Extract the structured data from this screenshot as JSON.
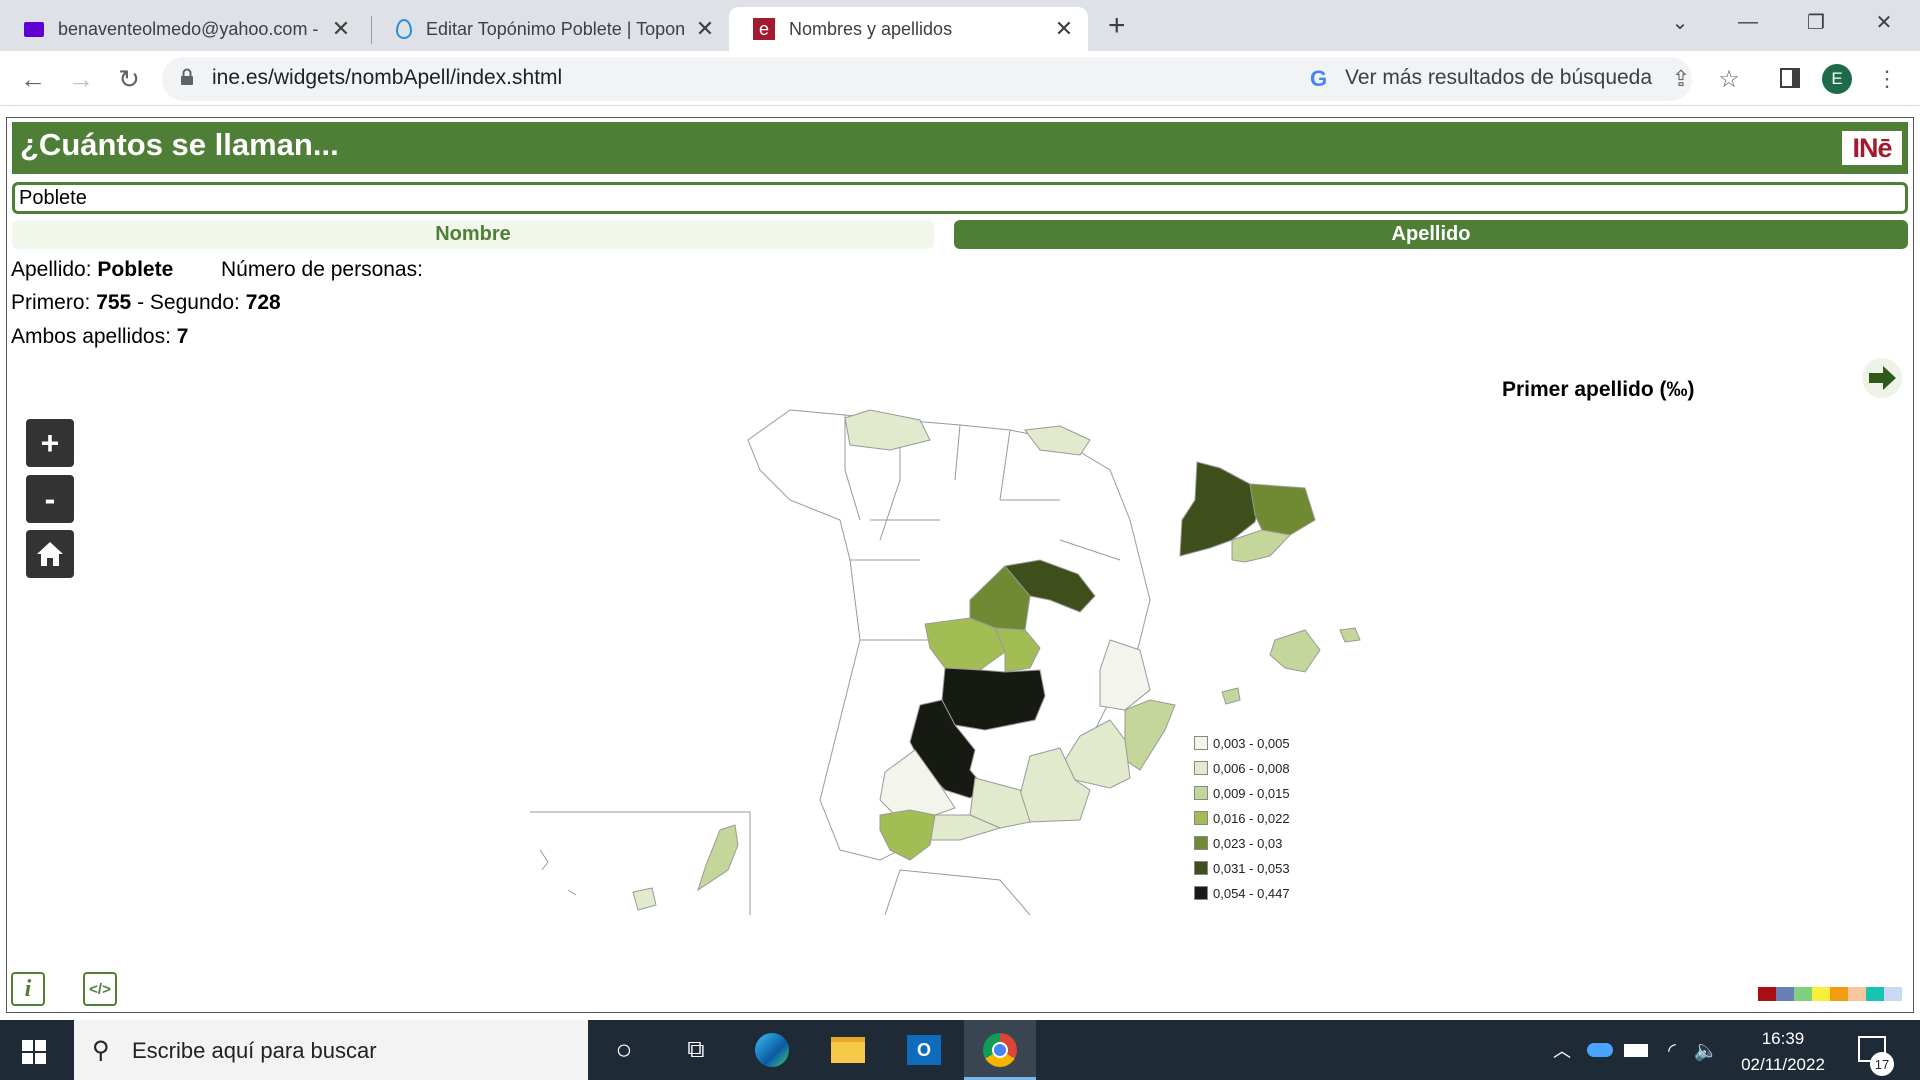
{
  "browser": {
    "tabs": [
      {
        "label": "benaventeolmedo@yahoo.com -",
        "icon": "mail-icon"
      },
      {
        "label": "Editar Topónimo Poblete | Topon",
        "icon": "drupal-icon"
      },
      {
        "label": "Nombres y apellidos",
        "icon": "ine-favicon-icon",
        "active": true
      }
    ],
    "new_tab": "+",
    "url": "ine.es/widgets/nombApell/index.shtml",
    "google_suggest": "Ver más resultados de búsqueda",
    "profile_initial": "E"
  },
  "page": {
    "title": "¿Cuántos se llaman...",
    "logo_text": "INē",
    "search_value": "Poblete",
    "tabs": {
      "nombre": "Nombre",
      "apellido": "Apellido"
    },
    "result": {
      "apellido_label": "Apellido:",
      "apellido_value": "Poblete",
      "numero_label": "Número de personas:",
      "primero_label": "Primero:",
      "primero_value": "755",
      "segundo_label": "- Segundo:",
      "segundo_value": "728",
      "ambos_label": "Ambos apellidos:",
      "ambos_value": "7"
    },
    "map": {
      "title": "Primer apellido (‰)",
      "zoom_in": "+",
      "zoom_out": "-",
      "legend": [
        {
          "label": "0,003 - 0,005",
          "color": "#f3f5ec"
        },
        {
          "label": "0,006 - 0,008",
          "color": "#e2eacd"
        },
        {
          "label": "0,009 - 0,015",
          "color": "#c4d699"
        },
        {
          "label": "0,016 - 0,022",
          "color": "#a3bd55"
        },
        {
          "label": "0,023 - 0,03",
          "color": "#6f8a32"
        },
        {
          "label": "0,031 - 0,053",
          "color": "#3f4f1c"
        },
        {
          "label": "0,054 - 0,447",
          "color": "#171a12"
        }
      ]
    },
    "palette_colors": [
      "#a50f15",
      "#6a7fb5",
      "#7fcf7f",
      "#f6f03c",
      "#f39c12",
      "#f7c59f",
      "#17c3b2",
      "#c9d9f5"
    ]
  },
  "taskbar": {
    "search_placeholder": "Escribe aquí para buscar",
    "time": "16:39",
    "date": "02/11/2022",
    "notifications": "17"
  }
}
